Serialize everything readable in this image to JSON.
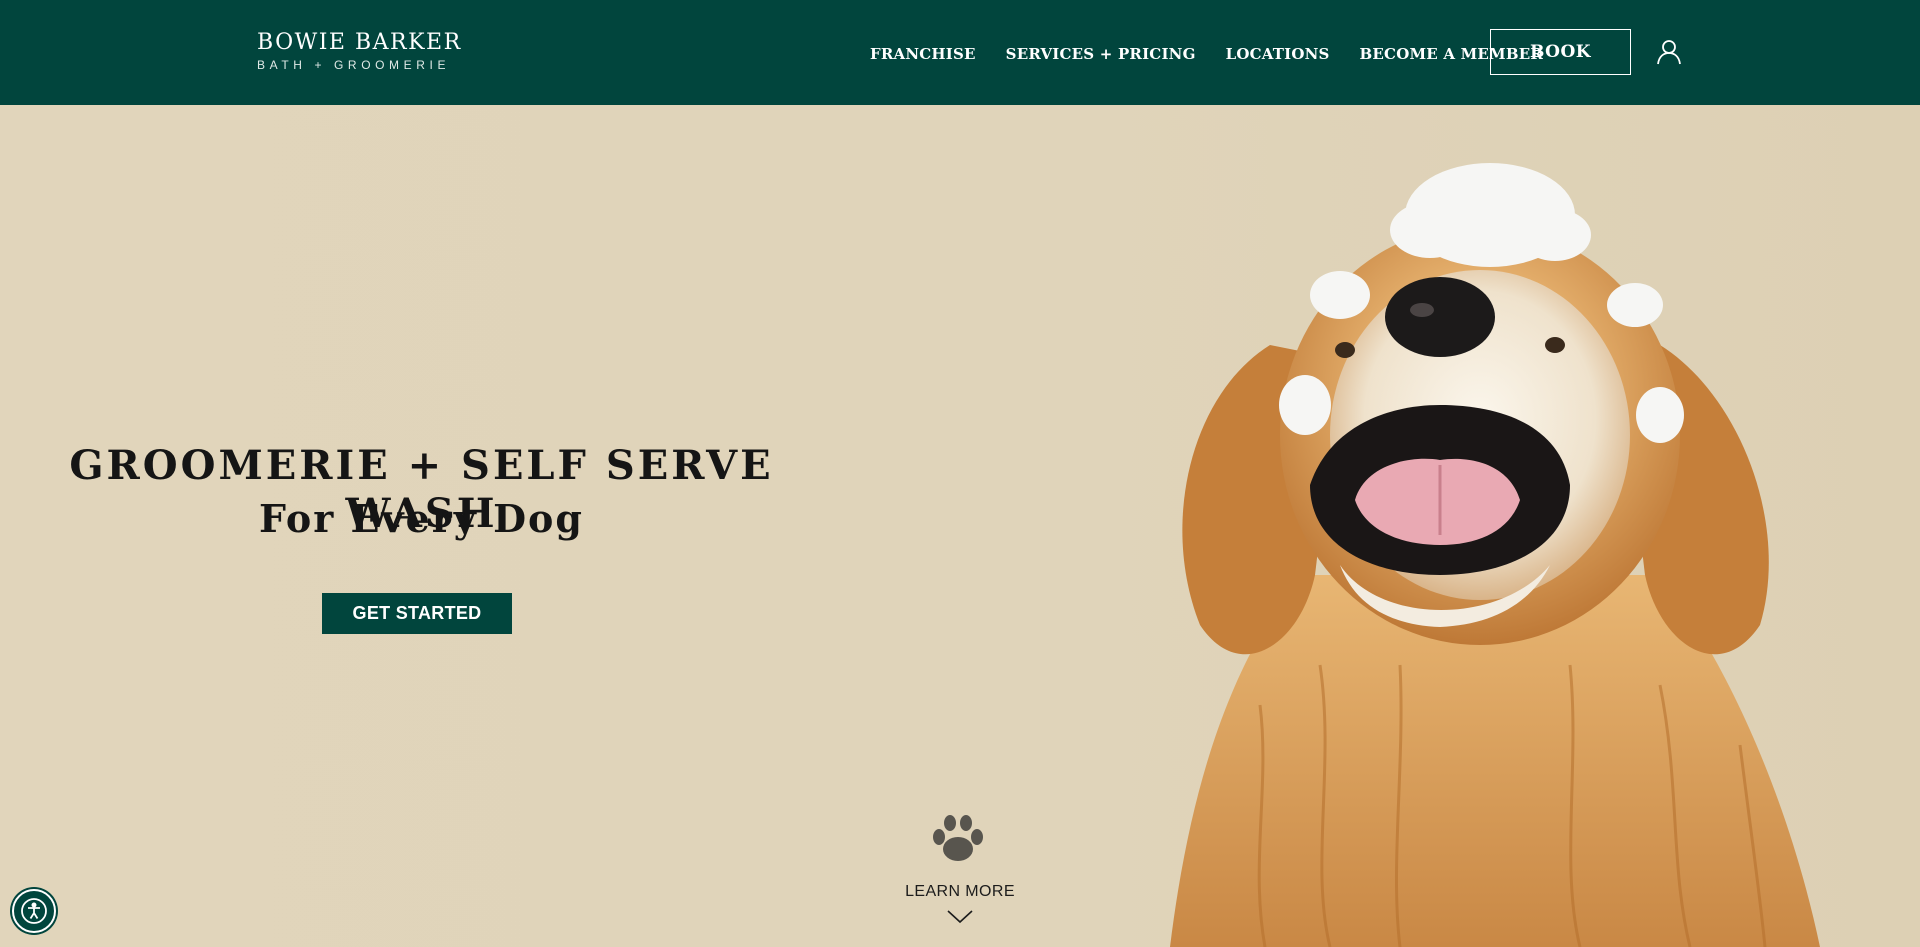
{
  "header": {
    "logo_main": "BOWIE BARKER",
    "logo_sub": "BATH + GROOMERIE",
    "nav": [
      "FRANCHISE",
      "SERVICES + PRICING",
      "LOCATIONS",
      "BECOME A MEMBER"
    ],
    "book_label": "BOOK",
    "account_icon": "user-icon"
  },
  "hero": {
    "title": "GROOMERIE + SELF SERVE WASH",
    "subtitle": "For Every Dog",
    "cta_label": "GET STARTED",
    "learn_more_label": "LEARN MORE",
    "scroll_icon": "chevron-down-icon",
    "paw_icon": "paw-print-icon",
    "image": "golden-retriever-with-bath-foam"
  },
  "accessibility": {
    "icon": "accessibility-icon"
  },
  "colors": {
    "brand_green": "#01453d",
    "hero_bg": "#e1d5bb",
    "text_dark": "#151515"
  }
}
